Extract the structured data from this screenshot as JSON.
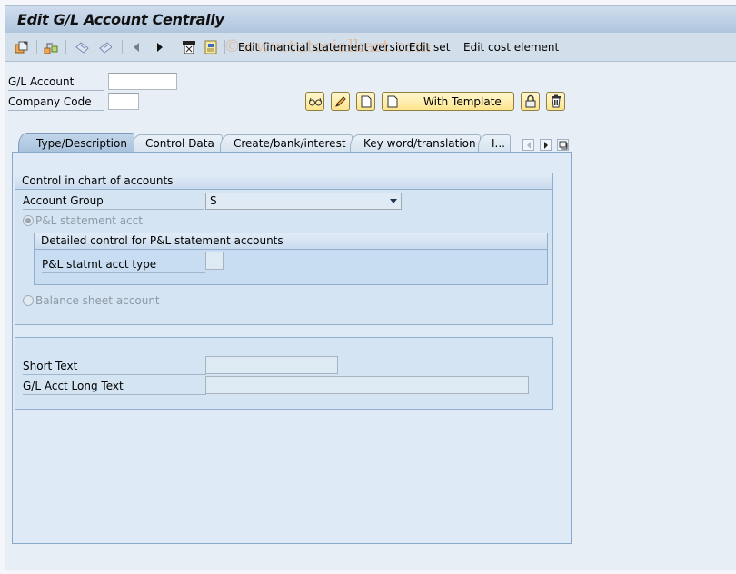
{
  "window": {
    "title": "Edit G/L Account Centrally"
  },
  "toolbar": {
    "icons": [
      "other-object-icon",
      "hierarchy-icon",
      "undo-icon",
      "redo-icon",
      "previous-icon",
      "next-icon",
      "financial-statement-icon",
      "document-icon"
    ],
    "links": [
      "Edit financial statement version",
      "Edit set",
      "Edit cost element"
    ],
    "watermark": "©www.tutorialkart.com"
  },
  "header_fields": {
    "gl_account": {
      "label": "G/L Account",
      "value": ""
    },
    "company_code": {
      "label": "Company Code",
      "value": ""
    }
  },
  "action_buttons": {
    "display": "display-glasses-icon",
    "change": "pencil-icon",
    "create": "new-document-icon",
    "with_template": "With Template",
    "lock": "lock-icon",
    "delete": "trash-icon"
  },
  "tabs": [
    {
      "label": "Type/Description",
      "active": true
    },
    {
      "label": "Control Data",
      "active": false
    },
    {
      "label": "Create/bank/interest",
      "active": false
    },
    {
      "label": "Key word/translation",
      "active": false
    },
    {
      "label": "I...",
      "active": false
    }
  ],
  "control_group": {
    "title": "Control in chart of accounts",
    "account_group": {
      "label": "Account Group",
      "value": "S"
    },
    "pl_radio": {
      "label": "P&L statement acct",
      "selected": true
    },
    "pl_detail": {
      "title": "Detailed control for P&L statement accounts",
      "acct_type": {
        "label": "P&L statmt acct type",
        "value": ""
      }
    },
    "bs_radio": {
      "label": "Balance sheet account",
      "selected": false
    }
  },
  "text_group": {
    "short_text": {
      "label": "Short Text",
      "value": ""
    },
    "long_text": {
      "label": "G/L Acct Long Text",
      "value": ""
    }
  }
}
